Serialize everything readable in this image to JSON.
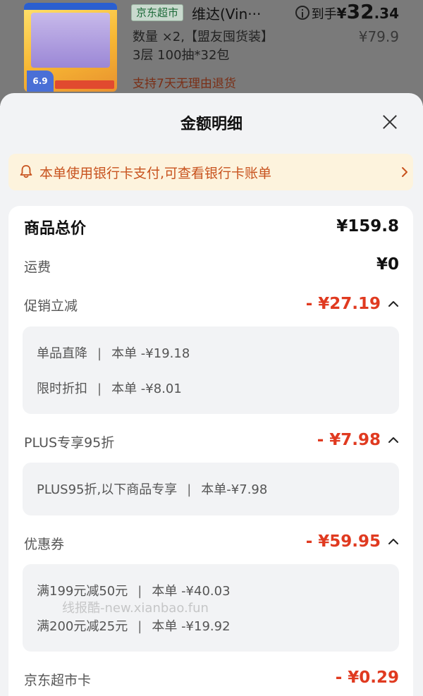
{
  "product": {
    "store_tag": "京东超市",
    "title": "维达(Vin···",
    "net_price_label": "到手",
    "net_price_symbol": "¥",
    "net_price_int": "32",
    "net_price_dec": ".34",
    "original_price": "¥79.9",
    "spec": "数量 ×2,【盟友囤货装】3层 100抽*32包",
    "return_policy": "支持7天无理由退货",
    "thumb_badge": "6.9"
  },
  "sheet": {
    "title": "金额明细",
    "notice": "本单使用银行卡支付,可查看银行卡账单",
    "total": {
      "label": "商品总价",
      "value": "¥159.8"
    },
    "shipping": {
      "label": "运费",
      "value": "¥0"
    },
    "promotion": {
      "label": "促销立减",
      "value": "- ¥27.19",
      "details": [
        {
          "name": "单品直降",
          "amount": "本单 -¥19.18"
        },
        {
          "name": "限时折扣",
          "amount": "本单 -¥8.01"
        }
      ]
    },
    "plus": {
      "label": "PLUS专享95折",
      "value": "- ¥7.98",
      "details": [
        {
          "name": "PLUS95折,以下商品专享",
          "amount": "本单-¥7.98"
        }
      ]
    },
    "coupon": {
      "label": "优惠券",
      "value": "- ¥59.95",
      "details": [
        {
          "name": "满199元减50元",
          "amount": "本单 -¥40.03"
        },
        {
          "name": "满200元减25元",
          "amount": "本单 -¥19.92"
        }
      ]
    },
    "supermarket_card": {
      "label": "京东超市卡",
      "value": "- ¥0.29"
    }
  },
  "watermark": "线报酷-new.xianbao.fun",
  "colors": {
    "accent_red": "#e03a20",
    "notice_orange": "#c8531e",
    "notice_bg": "#fdf3dd"
  }
}
